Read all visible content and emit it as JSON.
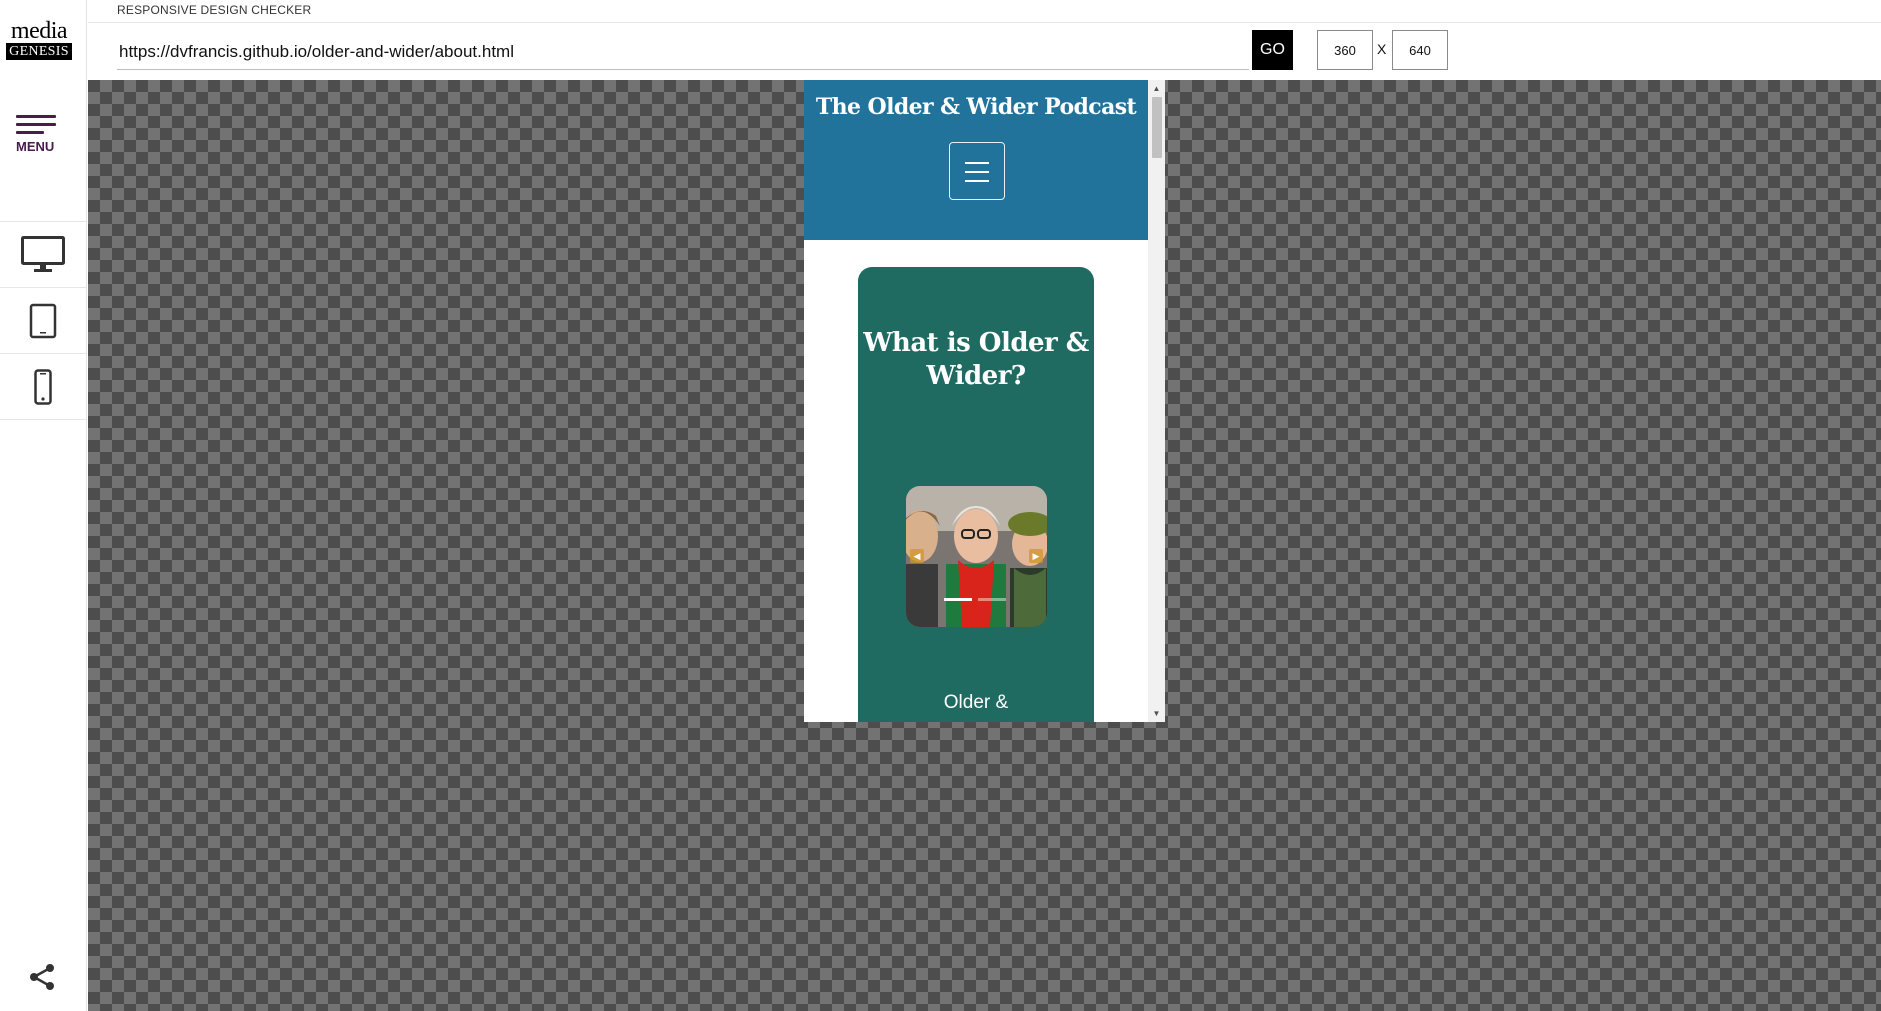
{
  "logo": {
    "top": "media",
    "bottom": "GENESIS"
  },
  "sidebar": {
    "menu_label": "MENU",
    "devices": [
      {
        "name": "desktop",
        "icon": "desktop-monitor-icon"
      },
      {
        "name": "tablet",
        "icon": "tablet-icon"
      },
      {
        "name": "mobile",
        "icon": "smartphone-icon"
      }
    ],
    "share_icon": "share-icon",
    "accent_color": "#4a1b4c"
  },
  "header": {
    "title": "RESPONSIVE DESIGN CHECKER",
    "url": "https://dvfrancis.github.io/older-and-wider/about.html",
    "go_label": "GO",
    "width": "360",
    "separator": "X",
    "height": "640"
  },
  "preview": {
    "site_title": "The Older & Wider Podcast",
    "header_color": "#22739b",
    "card_color": "#1f6b62",
    "card_heading": "What is Older & Wider?",
    "card_text": "Older &",
    "carousel": {
      "prev_icon": "chevron-left-icon",
      "next_icon": "chevron-right-icon",
      "slide_count": 2,
      "active_slide": 1
    }
  }
}
